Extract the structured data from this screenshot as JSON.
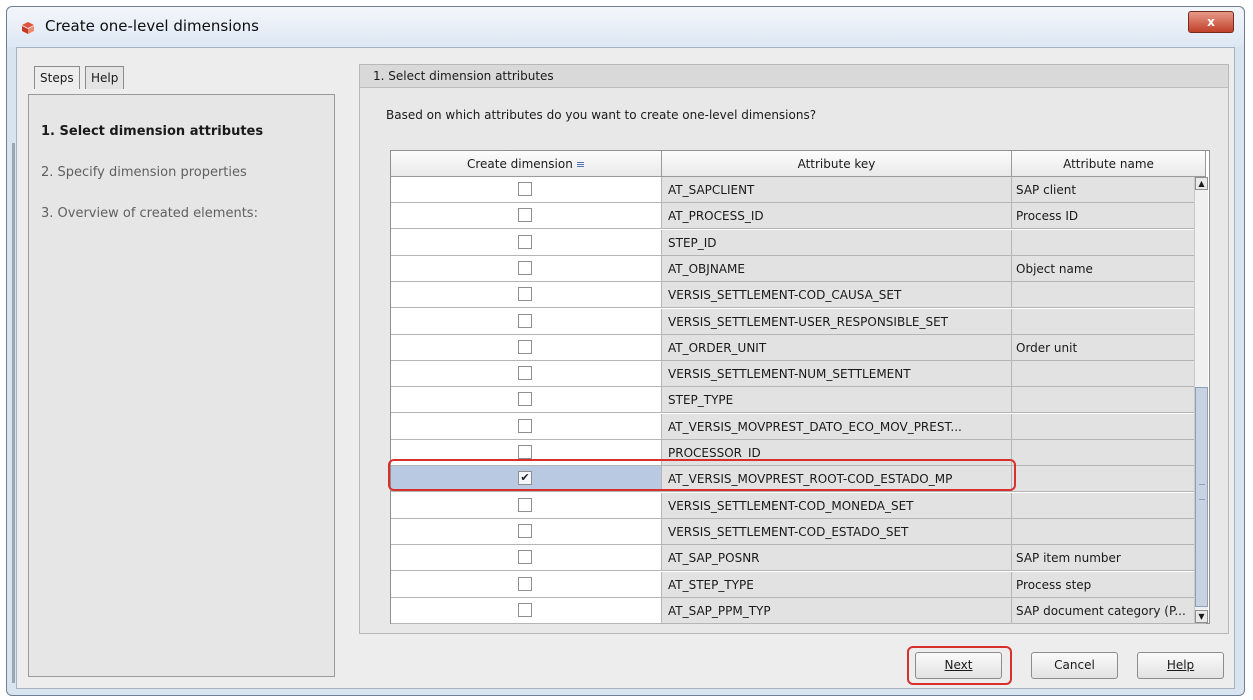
{
  "window": {
    "title": "Create one-level dimensions",
    "close_glyph": "x"
  },
  "tabs": [
    {
      "label": "Steps"
    },
    {
      "label": "Help"
    }
  ],
  "steps": [
    {
      "label": "1. Select dimension attributes",
      "active": true
    },
    {
      "label": "2. Specify dimension properties",
      "active": false
    },
    {
      "label": "3. Overview of created elements:",
      "active": false
    }
  ],
  "panel": {
    "header": "1. Select dimension attributes",
    "question": "Based on which attributes do you want to create one-level dimensions?"
  },
  "table": {
    "columns": [
      "Create dimension",
      "Attribute key",
      "Attribute name"
    ],
    "rows": [
      {
        "checked": false,
        "key": "AT_SAPCLIENT",
        "name": "SAP client"
      },
      {
        "checked": false,
        "key": "AT_PROCESS_ID",
        "name": "Process ID"
      },
      {
        "checked": false,
        "key": "STEP_ID",
        "name": ""
      },
      {
        "checked": false,
        "key": "AT_OBJNAME",
        "name": "Object name"
      },
      {
        "checked": false,
        "key": "VERSIS_SETTLEMENT-COD_CAUSA_SET",
        "name": ""
      },
      {
        "checked": false,
        "key": "VERSIS_SETTLEMENT-USER_RESPONSIBLE_SET",
        "name": ""
      },
      {
        "checked": false,
        "key": "AT_ORDER_UNIT",
        "name": "Order unit"
      },
      {
        "checked": false,
        "key": "VERSIS_SETTLEMENT-NUM_SETTLEMENT",
        "name": ""
      },
      {
        "checked": false,
        "key": "STEP_TYPE",
        "name": ""
      },
      {
        "checked": false,
        "key": "AT_VERSIS_MOVPREST_DATO_ECO_MOV_PREST...",
        "name": ""
      },
      {
        "checked": false,
        "key": "PROCESSOR_ID",
        "name": ""
      },
      {
        "checked": true,
        "key": "AT_VERSIS_MOVPREST_ROOT-COD_ESTADO_MP",
        "name": ""
      },
      {
        "checked": false,
        "key": "VERSIS_SETTLEMENT-COD_MONEDA_SET",
        "name": ""
      },
      {
        "checked": false,
        "key": "VERSIS_SETTLEMENT-COD_ESTADO_SET",
        "name": ""
      },
      {
        "checked": false,
        "key": "AT_SAP_POSNR",
        "name": "SAP item number"
      },
      {
        "checked": false,
        "key": "AT_STEP_TYPE",
        "name": "Process step"
      },
      {
        "checked": false,
        "key": "AT_SAP_PPM_TYP",
        "name": "SAP document category (P..."
      }
    ]
  },
  "buttons": {
    "next": "Next",
    "cancel": "Cancel",
    "help": "Help"
  },
  "icons": {
    "app": "sap-cube-icon",
    "sort": "sort-descending-icon",
    "check": "checkmark-icon"
  },
  "colors": {
    "highlight": "#d9302d",
    "selected_row": "#b9c9e2"
  }
}
